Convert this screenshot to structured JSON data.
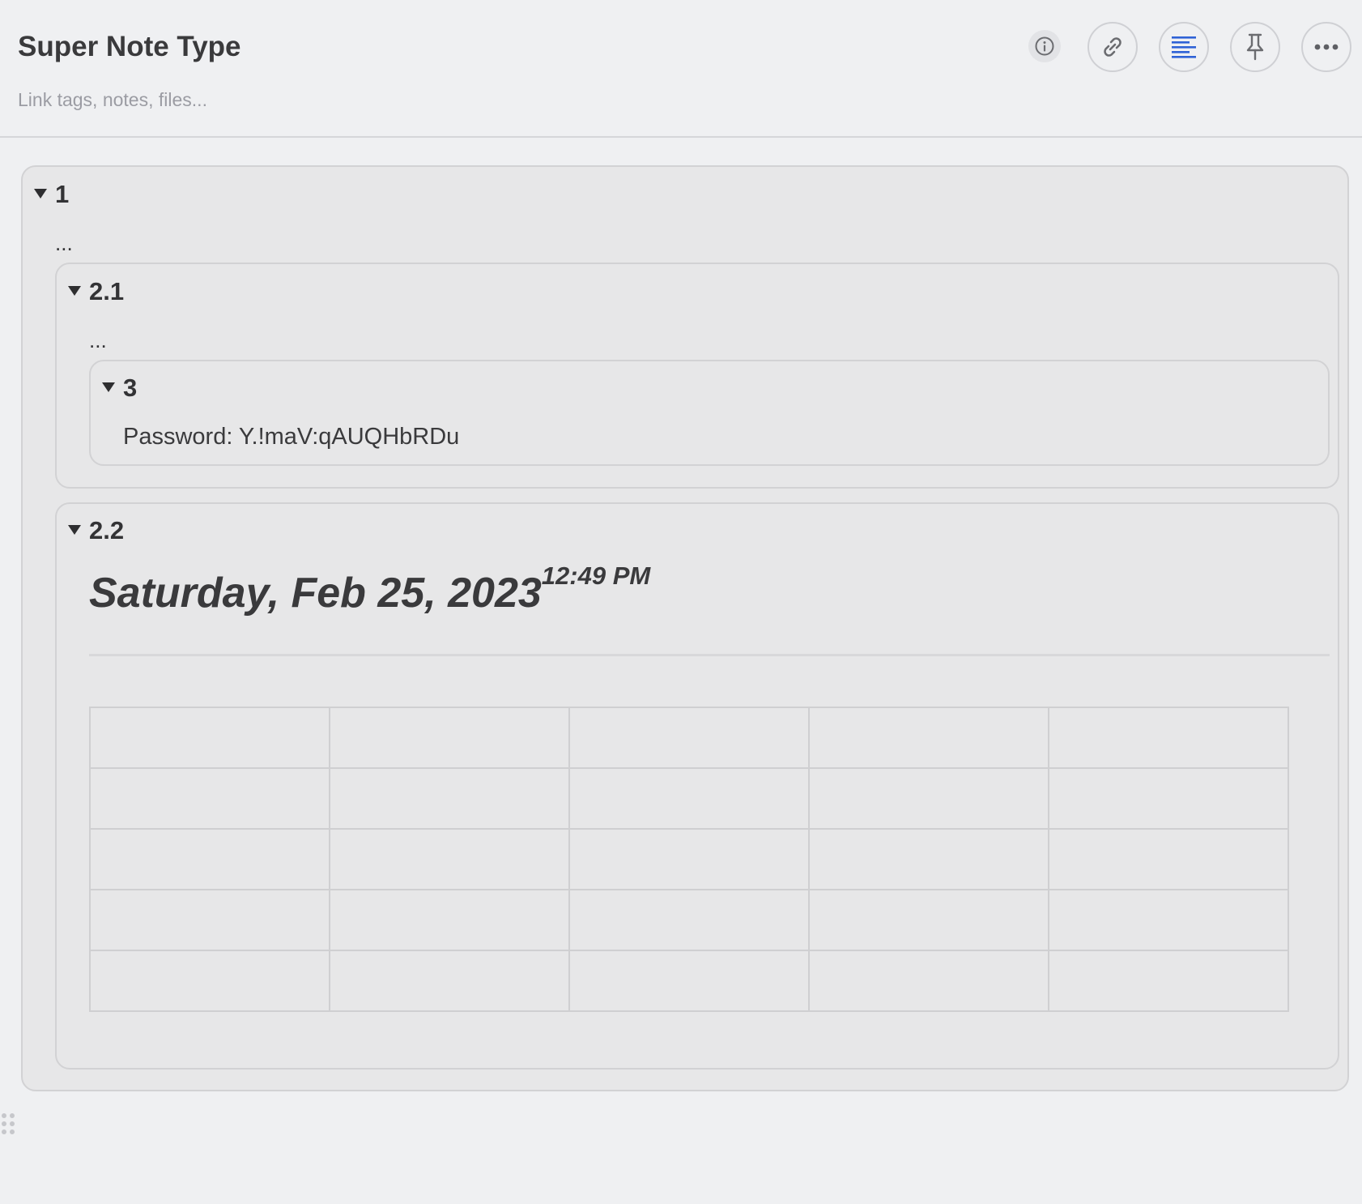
{
  "note": {
    "title": "Super Note Type",
    "link_placeholder": "Link tags, notes, files..."
  },
  "toolbar": {
    "icons": [
      "info-icon",
      "link-icon",
      "align-left-icon",
      "pin-icon",
      "more-icon"
    ],
    "accent_color": "#2f62d6"
  },
  "blocks": {
    "b1": {
      "heading": "1",
      "body": "..."
    },
    "b21": {
      "heading": "2.1",
      "body": "..."
    },
    "b3": {
      "heading": "3",
      "body": "Password: Y.!maV:qAUQHbRDu"
    },
    "b22": {
      "heading": "2.2",
      "date": "Saturday, Feb 25, 2023",
      "time": "12:49 PM"
    }
  },
  "table": {
    "rows": 5,
    "cols": 5,
    "cells": [
      [
        "",
        "",
        "",
        "",
        ""
      ],
      [
        "",
        "",
        "",
        "",
        ""
      ],
      [
        "",
        "",
        "",
        "",
        ""
      ],
      [
        "",
        "",
        "",
        "",
        ""
      ],
      [
        "",
        "",
        "",
        "",
        ""
      ]
    ]
  }
}
